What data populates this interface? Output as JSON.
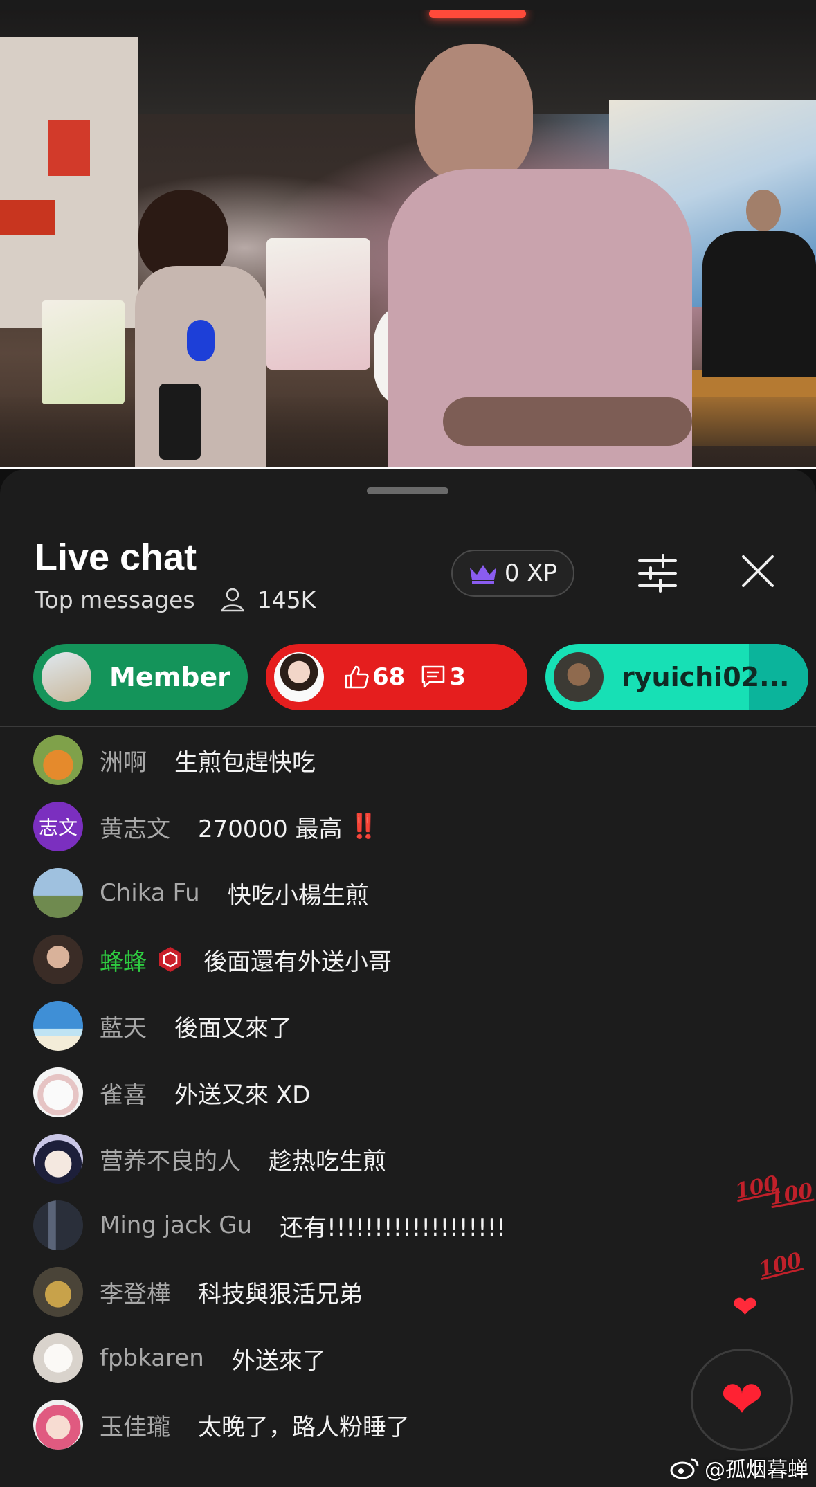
{
  "video": {
    "description_icon": "video-frame",
    "progress_fraction": 1.0
  },
  "header": {
    "title": "Live chat",
    "subtitle": "Top messages",
    "viewer_count": "145K",
    "xp_label": "0 XP"
  },
  "chips": {
    "member_label": "Member",
    "likes": "68",
    "comments": "3",
    "user_label": "ryuichi02..."
  },
  "messages": [
    {
      "author": "洲啊",
      "text": "生煎包趕快吃",
      "avatar_color": "#3c6a3a",
      "avatar_icon": "fox-avatar"
    },
    {
      "author": "黄志文",
      "text": "270000 最高",
      "avatar_text": "志文",
      "avatar_color": "#7b2fbf",
      "extra": "‼️"
    },
    {
      "author": "Chika Fu",
      "text": "快吃小楊生煎",
      "avatar_color": "#6c8fb5"
    },
    {
      "author": "蜂蜂",
      "text": "後面還有外送小哥",
      "avatar_color": "#5a4a40",
      "member": true
    },
    {
      "author": "藍天",
      "text": "後面又來了",
      "avatar_color": "#3f8fd6"
    },
    {
      "author": "雀喜",
      "text": "外送又來 XD",
      "avatar_color": "#f0f0f0"
    },
    {
      "author": "营养不良的人",
      "text": "趁热吃生煎",
      "avatar_color": "#c9c6e6"
    },
    {
      "author": "Ming jack Gu",
      "text": "还有!!!!!!!!!!!!!!!!!!!",
      "avatar_color": "#2a2f3a"
    },
    {
      "author": "李登樺",
      "text": "科技與狠活兄弟",
      "avatar_color": "#8a7a4a"
    },
    {
      "author": "fpbkaren",
      "text": "外送來了",
      "avatar_color": "#e8e4e0"
    },
    {
      "author": "玉佳瓏",
      "text": "太晚了，路人粉睡了",
      "avatar_color": "#e07a9a"
    }
  ],
  "reactions": {
    "hundred_label": "100"
  },
  "watermark": "@孤烟暮蝉",
  "colors": {
    "panel_bg": "#1c1c1c",
    "member_green": "#14945a",
    "heart_red": "#e51e1e",
    "user_teal": "#17e0b5"
  }
}
